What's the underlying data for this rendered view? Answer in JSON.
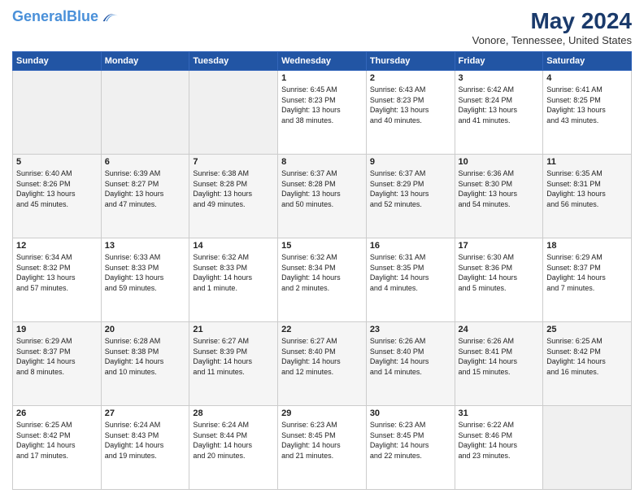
{
  "header": {
    "logo_line1": "General",
    "logo_line2": "Blue",
    "month_year": "May 2024",
    "location": "Vonore, Tennessee, United States"
  },
  "weekdays": [
    "Sunday",
    "Monday",
    "Tuesday",
    "Wednesday",
    "Thursday",
    "Friday",
    "Saturday"
  ],
  "weeks": [
    [
      {
        "day": "",
        "info": ""
      },
      {
        "day": "",
        "info": ""
      },
      {
        "day": "",
        "info": ""
      },
      {
        "day": "1",
        "info": "Sunrise: 6:45 AM\nSunset: 8:23 PM\nDaylight: 13 hours\nand 38 minutes."
      },
      {
        "day": "2",
        "info": "Sunrise: 6:43 AM\nSunset: 8:23 PM\nDaylight: 13 hours\nand 40 minutes."
      },
      {
        "day": "3",
        "info": "Sunrise: 6:42 AM\nSunset: 8:24 PM\nDaylight: 13 hours\nand 41 minutes."
      },
      {
        "day": "4",
        "info": "Sunrise: 6:41 AM\nSunset: 8:25 PM\nDaylight: 13 hours\nand 43 minutes."
      }
    ],
    [
      {
        "day": "5",
        "info": "Sunrise: 6:40 AM\nSunset: 8:26 PM\nDaylight: 13 hours\nand 45 minutes."
      },
      {
        "day": "6",
        "info": "Sunrise: 6:39 AM\nSunset: 8:27 PM\nDaylight: 13 hours\nand 47 minutes."
      },
      {
        "day": "7",
        "info": "Sunrise: 6:38 AM\nSunset: 8:28 PM\nDaylight: 13 hours\nand 49 minutes."
      },
      {
        "day": "8",
        "info": "Sunrise: 6:37 AM\nSunset: 8:28 PM\nDaylight: 13 hours\nand 50 minutes."
      },
      {
        "day": "9",
        "info": "Sunrise: 6:37 AM\nSunset: 8:29 PM\nDaylight: 13 hours\nand 52 minutes."
      },
      {
        "day": "10",
        "info": "Sunrise: 6:36 AM\nSunset: 8:30 PM\nDaylight: 13 hours\nand 54 minutes."
      },
      {
        "day": "11",
        "info": "Sunrise: 6:35 AM\nSunset: 8:31 PM\nDaylight: 13 hours\nand 56 minutes."
      }
    ],
    [
      {
        "day": "12",
        "info": "Sunrise: 6:34 AM\nSunset: 8:32 PM\nDaylight: 13 hours\nand 57 minutes."
      },
      {
        "day": "13",
        "info": "Sunrise: 6:33 AM\nSunset: 8:33 PM\nDaylight: 13 hours\nand 59 minutes."
      },
      {
        "day": "14",
        "info": "Sunrise: 6:32 AM\nSunset: 8:33 PM\nDaylight: 14 hours\nand 1 minute."
      },
      {
        "day": "15",
        "info": "Sunrise: 6:32 AM\nSunset: 8:34 PM\nDaylight: 14 hours\nand 2 minutes."
      },
      {
        "day": "16",
        "info": "Sunrise: 6:31 AM\nSunset: 8:35 PM\nDaylight: 14 hours\nand 4 minutes."
      },
      {
        "day": "17",
        "info": "Sunrise: 6:30 AM\nSunset: 8:36 PM\nDaylight: 14 hours\nand 5 minutes."
      },
      {
        "day": "18",
        "info": "Sunrise: 6:29 AM\nSunset: 8:37 PM\nDaylight: 14 hours\nand 7 minutes."
      }
    ],
    [
      {
        "day": "19",
        "info": "Sunrise: 6:29 AM\nSunset: 8:37 PM\nDaylight: 14 hours\nand 8 minutes."
      },
      {
        "day": "20",
        "info": "Sunrise: 6:28 AM\nSunset: 8:38 PM\nDaylight: 14 hours\nand 10 minutes."
      },
      {
        "day": "21",
        "info": "Sunrise: 6:27 AM\nSunset: 8:39 PM\nDaylight: 14 hours\nand 11 minutes."
      },
      {
        "day": "22",
        "info": "Sunrise: 6:27 AM\nSunset: 8:40 PM\nDaylight: 14 hours\nand 12 minutes."
      },
      {
        "day": "23",
        "info": "Sunrise: 6:26 AM\nSunset: 8:40 PM\nDaylight: 14 hours\nand 14 minutes."
      },
      {
        "day": "24",
        "info": "Sunrise: 6:26 AM\nSunset: 8:41 PM\nDaylight: 14 hours\nand 15 minutes."
      },
      {
        "day": "25",
        "info": "Sunrise: 6:25 AM\nSunset: 8:42 PM\nDaylight: 14 hours\nand 16 minutes."
      }
    ],
    [
      {
        "day": "26",
        "info": "Sunrise: 6:25 AM\nSunset: 8:42 PM\nDaylight: 14 hours\nand 17 minutes."
      },
      {
        "day": "27",
        "info": "Sunrise: 6:24 AM\nSunset: 8:43 PM\nDaylight: 14 hours\nand 19 minutes."
      },
      {
        "day": "28",
        "info": "Sunrise: 6:24 AM\nSunset: 8:44 PM\nDaylight: 14 hours\nand 20 minutes."
      },
      {
        "day": "29",
        "info": "Sunrise: 6:23 AM\nSunset: 8:45 PM\nDaylight: 14 hours\nand 21 minutes."
      },
      {
        "day": "30",
        "info": "Sunrise: 6:23 AM\nSunset: 8:45 PM\nDaylight: 14 hours\nand 22 minutes."
      },
      {
        "day": "31",
        "info": "Sunrise: 6:22 AM\nSunset: 8:46 PM\nDaylight: 14 hours\nand 23 minutes."
      },
      {
        "day": "",
        "info": ""
      }
    ]
  ]
}
